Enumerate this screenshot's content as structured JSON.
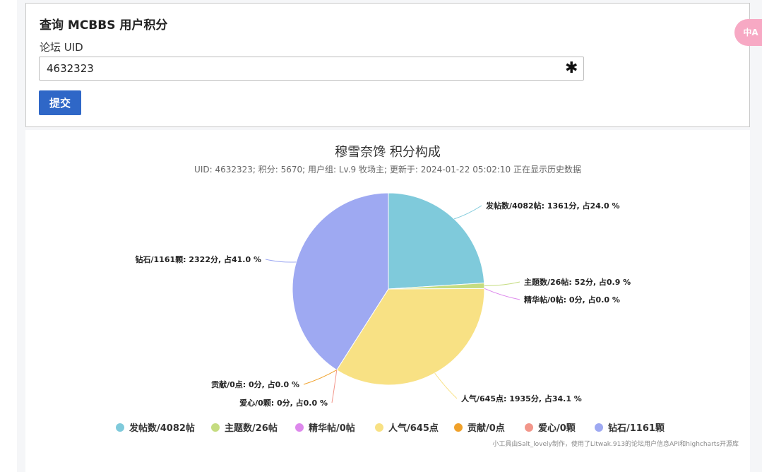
{
  "form": {
    "title": "查询 MCBBS 用户积分",
    "uid_label": "论坛 UID",
    "uid_value": "4632323",
    "required_mark": "✱",
    "submit_label": "提交"
  },
  "translate_icon": {
    "name": "translate-icon",
    "text": "中A"
  },
  "chart_data": {
    "type": "pie",
    "title": "穆雪奈馋 积分构成",
    "subtitle": "UID: 4632323; 积分: 5670; 用户组: Lv.9 牧场主; 更新于: 2024-01-22 05:02:10 正在显示历史数据",
    "slices": [
      {
        "legend": "发帖数/4082帖",
        "label": "发帖数/4082帖: 1361分, 占24.0 %",
        "value": 1361,
        "percent": 24.0,
        "color": "#7fcadb"
      },
      {
        "legend": "主题数/26帖",
        "label": "主题数/26帖: 52分, 占0.9 %",
        "value": 52,
        "percent": 0.9,
        "color": "#c5dc80"
      },
      {
        "legend": "精华帖/0帖",
        "label": "精华帖/0帖: 0分, 占0.0 %",
        "value": 0,
        "percent": 0.0,
        "color": "#dd88ec"
      },
      {
        "legend": "人气/645点",
        "label": "人气/645点: 1935分, 占34.1 %",
        "value": 1935,
        "percent": 34.1,
        "color": "#f8e184"
      },
      {
        "legend": "贡献/0点",
        "label": "贡献/0点: 0分, 占0.0 %",
        "value": 0,
        "percent": 0.0,
        "color": "#f0a12a"
      },
      {
        "legend": "爱心/0颗",
        "label": "爱心/0颗: 0分, 占0.0 %",
        "value": 0,
        "percent": 0.0,
        "color": "#f2968a"
      },
      {
        "legend": "钻石/1161颗",
        "label": "钻石/1161颗: 2322分, 占41.0 %",
        "value": 2322,
        "percent": 41.0,
        "color": "#9ea9f2"
      }
    ],
    "legend_position": "bottom-center"
  },
  "footer": {
    "credit": "小工具由Salt_lovely制作，使用了Litwak.913的论坛用户信息API和highcharts开源库"
  }
}
